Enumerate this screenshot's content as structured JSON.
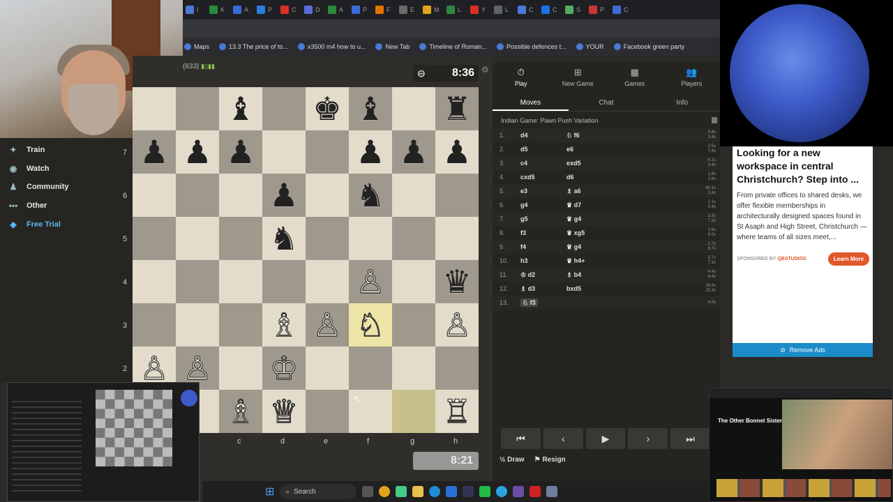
{
  "browser": {
    "tab_labels": [
      "I",
      "K",
      "A",
      "P",
      "C",
      "D",
      "A",
      "P",
      "F",
      "E",
      "M",
      "L",
      "Y",
      "L",
      "C",
      "C",
      "S",
      "P",
      "C"
    ],
    "bookmarks": [
      "Maps",
      "13.3 The price of to...",
      "x3500 m4 how to u...",
      "New Tab",
      "Timeline of Roman...",
      "Possible defences t...",
      "YOUR",
      "Facebook green party"
    ]
  },
  "left_nav": {
    "items": [
      {
        "icon": "target-icon",
        "label": "Train"
      },
      {
        "icon": "binoculars-icon",
        "label": "Watch"
      },
      {
        "icon": "community-icon",
        "label": "Community"
      },
      {
        "icon": "more-dots-icon",
        "label": "Other"
      },
      {
        "icon": "diamond-icon",
        "label": "Free Trial"
      }
    ]
  },
  "opponent": {
    "rating": "(633)",
    "clock": "8:36"
  },
  "player": {
    "clock": "8:21"
  },
  "board": {
    "rank_labels": [
      "7",
      "6",
      "5",
      "4",
      "3",
      "2"
    ],
    "file_labels": [
      "c",
      "d",
      "e",
      "f",
      "g",
      "h"
    ],
    "rows": [
      [
        "",
        "",
        "♝",
        "",
        "♚",
        "♝",
        "",
        "♜"
      ],
      [
        "♟",
        "♟",
        "♟",
        "",
        "",
        "♟",
        "♟",
        "♟"
      ],
      [
        "",
        "",
        "",
        "♟",
        "",
        "♞",
        "",
        ""
      ],
      [
        "",
        "",
        "",
        "♞",
        "",
        "",
        "",
        ""
      ],
      [
        "",
        "",
        "",
        "",
        "",
        "♙",
        "",
        "♛"
      ],
      [
        "",
        "",
        "",
        "♗",
        "♙",
        "♘",
        "",
        "♙"
      ],
      [
        "♙",
        "♙",
        "",
        "♔",
        "",
        "",
        "",
        ""
      ],
      [
        "",
        "",
        "♗",
        "♕",
        "",
        "",
        "",
        "♖"
      ]
    ]
  },
  "panel": {
    "top_tabs": [
      {
        "icon": "stopwatch-icon",
        "label": "Play"
      },
      {
        "icon": "plus-icon",
        "label": "New Game"
      },
      {
        "icon": "board-icon",
        "label": "Games"
      },
      {
        "icon": "players-icon",
        "label": "Players"
      }
    ],
    "sub_tabs": [
      "Moves",
      "Chat",
      "Info"
    ],
    "opening": "Indian Game: Pawn Push Variation",
    "moves": [
      {
        "num": "1.",
        "white": "d4",
        "black": "♘ f6",
        "times": [
          "0.4s",
          "3.4s"
        ]
      },
      {
        "num": "2.",
        "white": "d5",
        "black": "e6",
        "times": [
          "2.5s",
          "7.4s"
        ]
      },
      {
        "num": "3.",
        "white": "c4",
        "black": "exd5",
        "times": [
          "4.1s",
          "3.4s"
        ]
      },
      {
        "num": "4.",
        "white": "cxd5",
        "black": "d6",
        "times": [
          "1.8s",
          "1.6s"
        ]
      },
      {
        "num": "5.",
        "white": "e3",
        "black": "♗ a6",
        "times": [
          "40.1s",
          "2.4s"
        ]
      },
      {
        "num": "6.",
        "white": "g4",
        "black": "♛ d7",
        "times": [
          "2.1s",
          "5.4s"
        ]
      },
      {
        "num": "7.",
        "white": "g5",
        "black": "♛ g4",
        "times": [
          "3.3s",
          "7.2s"
        ]
      },
      {
        "num": "8.",
        "white": "f3",
        "black": "♛ xg5",
        "times": [
          "2.6s",
          "8.0s"
        ]
      },
      {
        "num": "9.",
        "white": "f4",
        "black": "♛ g4",
        "times": [
          "2.7s",
          "8.7s"
        ]
      },
      {
        "num": "10.",
        "white": "h3",
        "black": "♛ h4+",
        "times": [
          "3.7s",
          "7.1s"
        ]
      },
      {
        "num": "11.",
        "white": "♔ d2",
        "black": "♗ b4",
        "times": [
          "4.4s",
          "4.4s"
        ]
      },
      {
        "num": "12.",
        "white": "♗ d3",
        "black": "bxd5",
        "times": [
          "26.5s",
          "20.3s"
        ]
      },
      {
        "num": "13.",
        "white": "♘ f3",
        "black": "",
        "times": [
          "4.0s",
          ""
        ]
      }
    ],
    "draw_label": "Draw",
    "resign_label": "Resign"
  },
  "ad": {
    "title": "Looking for a new workspace in central Christchurch? Step into ...",
    "body": "From private offices to shared desks, we offer flexible memberships in architecturally designed spaces found in St Asaph and High Street, Christchurch — where teams of all sizes meet,...",
    "sponsor_prefix": "SPONSORED BY",
    "sponsor": "QBSTUDIOS",
    "cta": "Learn More",
    "remove": "Remove Ads"
  },
  "thumbnail_right": {
    "title": "The Other Bonnet Sister"
  },
  "taskbar": {
    "search": "Search"
  }
}
